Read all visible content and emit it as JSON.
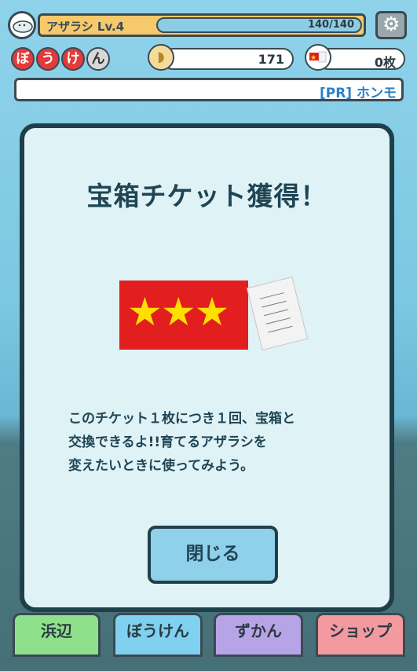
{
  "hud": {
    "player_name": "アザラシ Lv.4",
    "hp_text": "140/140",
    "hp_fraction": 1.0,
    "adventure_letters": [
      "ぼ",
      "う",
      "け",
      "ん"
    ],
    "shell_count": "171",
    "ticket_count": "0枚",
    "ad_text": "[PR] ホンモ"
  },
  "modal": {
    "title": "宝箱チケット獲得！",
    "ticket_stars": "★★★",
    "description_lines": [
      "このチケット１枚につき１回、宝箱と",
      "交換できるよ!!育てるアザラシを",
      "変えたいときに使ってみよう。"
    ],
    "close_label": "閉じる"
  },
  "tabs": {
    "beach": "浜辺",
    "adventure": "ぼうけん",
    "zukan": "ずかん",
    "shop": "ショップ"
  },
  "colors": {
    "modal_bg": "#dff2f6",
    "modal_border": "#1f3f4a",
    "ticket_red": "#e31e1e",
    "star_yellow": "#ffdf00",
    "button_blue": "#8fd0ea"
  }
}
